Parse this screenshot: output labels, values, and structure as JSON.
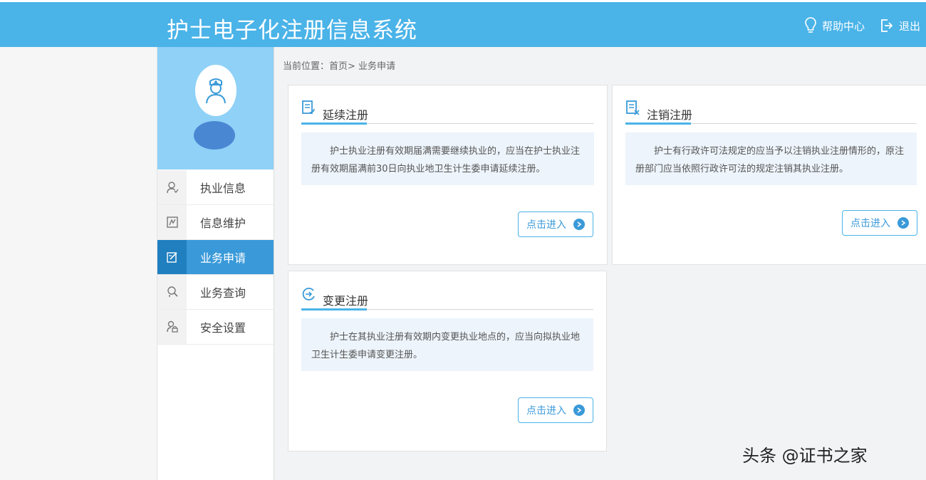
{
  "header": {
    "title": "护士电子化注册信息系统",
    "help_label": "帮助中心",
    "logout_label": "退出"
  },
  "sidebar": {
    "items": [
      {
        "label": "执业信息",
        "icon": "person-icon",
        "active": false
      },
      {
        "label": "信息维护",
        "icon": "edit-box-icon",
        "active": false
      },
      {
        "label": "业务申请",
        "icon": "document-edit-icon",
        "active": true
      },
      {
        "label": "业务查询",
        "icon": "search-person-icon",
        "active": false
      },
      {
        "label": "安全设置",
        "icon": "lock-person-icon",
        "active": false
      }
    ]
  },
  "breadcrumb": "当前位置：首页> 业务申请",
  "cards": [
    {
      "title": "延续注册",
      "icon": "renew-doc-icon",
      "description": "护士执业注册有效期届满需要继续执业的，应当在护士执业注册有效期届满前30日向执业地卫生计生委申请延续注册。",
      "button_label": "点击进入"
    },
    {
      "title": "注销注册",
      "icon": "cancel-doc-icon",
      "description": "护士有行政许可法规定的应当予以注销执业注册情形的，原注册部门应当依照行政许可法的规定注销其执业注册。",
      "button_label": "点击进入"
    },
    {
      "title": "变更注册",
      "icon": "change-arrow-icon",
      "description": "护士在其执业注册有效期内变更执业地点的，应当向拟执业地卫生计生委申请变更注册。",
      "button_label": "点击进入"
    }
  ],
  "watermark": "头条 @证书之家",
  "colors": {
    "header": "#4ab3e8",
    "profile_bg": "#8fd1f7",
    "active_menu": "#3a9ad9",
    "desc_bg": "#edf4fb"
  }
}
